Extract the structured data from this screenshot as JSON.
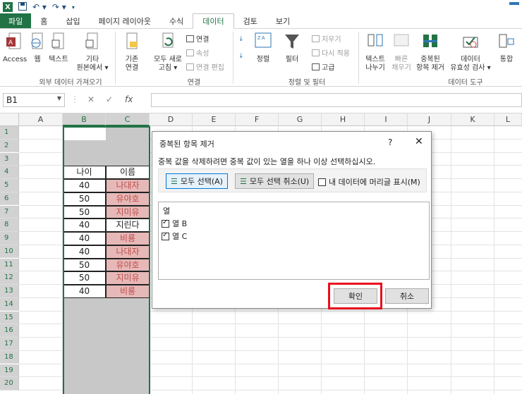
{
  "colors": {
    "excel_green": "#217346",
    "selection_gray": "#c8c8c8",
    "red_text": "#c0504d",
    "red_fill": "#e6b8b7",
    "highlight_red": "#e8101c"
  },
  "quick_access": {
    "icons": [
      "excel-logo-icon",
      "save-icon",
      "undo-icon",
      "redo-icon",
      "customize-icon"
    ]
  },
  "tabs": [
    "파일",
    "홈",
    "삽입",
    "페이지 레이아웃",
    "수식",
    "데이터",
    "검토",
    "보기"
  ],
  "ribbon": {
    "access": "Access",
    "web": "웹",
    "text": "텍스트",
    "other_sources": [
      "기타",
      "원본에서 ▾"
    ],
    "existing_connections": [
      "기존",
      "연결"
    ],
    "refresh_all": [
      "모두 새로",
      "고침 ▾"
    ],
    "connections": "연결",
    "properties": "속성",
    "edit_links": "연결 편집",
    "sort": "정렬",
    "filter": "필터",
    "clear": "지우기",
    "reapply": "다시 적용",
    "advanced": "고급",
    "text_to_columns": [
      "텍스트",
      "나누기"
    ],
    "flash_fill": [
      "빠른",
      "채우기"
    ],
    "remove_duplicates": [
      "중복된",
      "항목 제거"
    ],
    "data_validation": [
      "데이터",
      "유효성 검사 ▾"
    ],
    "consolidate": "통합",
    "groups": {
      "get_external": "외부 데이터 가져오기",
      "connections": "연결",
      "sort_filter": "정렬 및 필터",
      "data_tools": "데이터 도구"
    }
  },
  "formula_bar": {
    "name_box": "B1",
    "fx": "fx",
    "value": ""
  },
  "columns": [
    "A",
    "B",
    "C",
    "D",
    "E",
    "F",
    "G",
    "H",
    "I",
    "J",
    "K",
    "L"
  ],
  "rows": [
    "1",
    "2",
    "3",
    "4",
    "5",
    "6",
    "7",
    "8",
    "9",
    "10",
    "11",
    "12",
    "13",
    "14",
    "15",
    "16",
    "17",
    "18",
    "19",
    "20"
  ],
  "table": {
    "header": [
      "나이",
      "이름"
    ],
    "rows": [
      [
        "40",
        "나대자"
      ],
      [
        "50",
        "유야호"
      ],
      [
        "50",
        "지미유"
      ],
      [
        "40",
        "지린다"
      ],
      [
        "40",
        "비룡"
      ],
      [
        "40",
        "나대자"
      ],
      [
        "50",
        "유야호"
      ],
      [
        "50",
        "지미유"
      ],
      [
        "40",
        "비룡"
      ]
    ]
  },
  "dialog": {
    "title": "중복된 항목 제거",
    "help": "?",
    "close": "✕",
    "instruction": "중복 값을 삭제하려면 중복 값이 있는 열을 하나 이상 선택하십시오.",
    "select_all": "모두 선택(A)",
    "unselect_all": "모두 선택 취소(U)",
    "has_headers": "내 데이터에 머리글 표시(M)",
    "has_headers_checked": false,
    "column_header": "열",
    "columns": [
      {
        "label": "열 B",
        "checked": true
      },
      {
        "label": "열 C",
        "checked": true
      }
    ],
    "ok": "확인",
    "cancel": "취소"
  }
}
